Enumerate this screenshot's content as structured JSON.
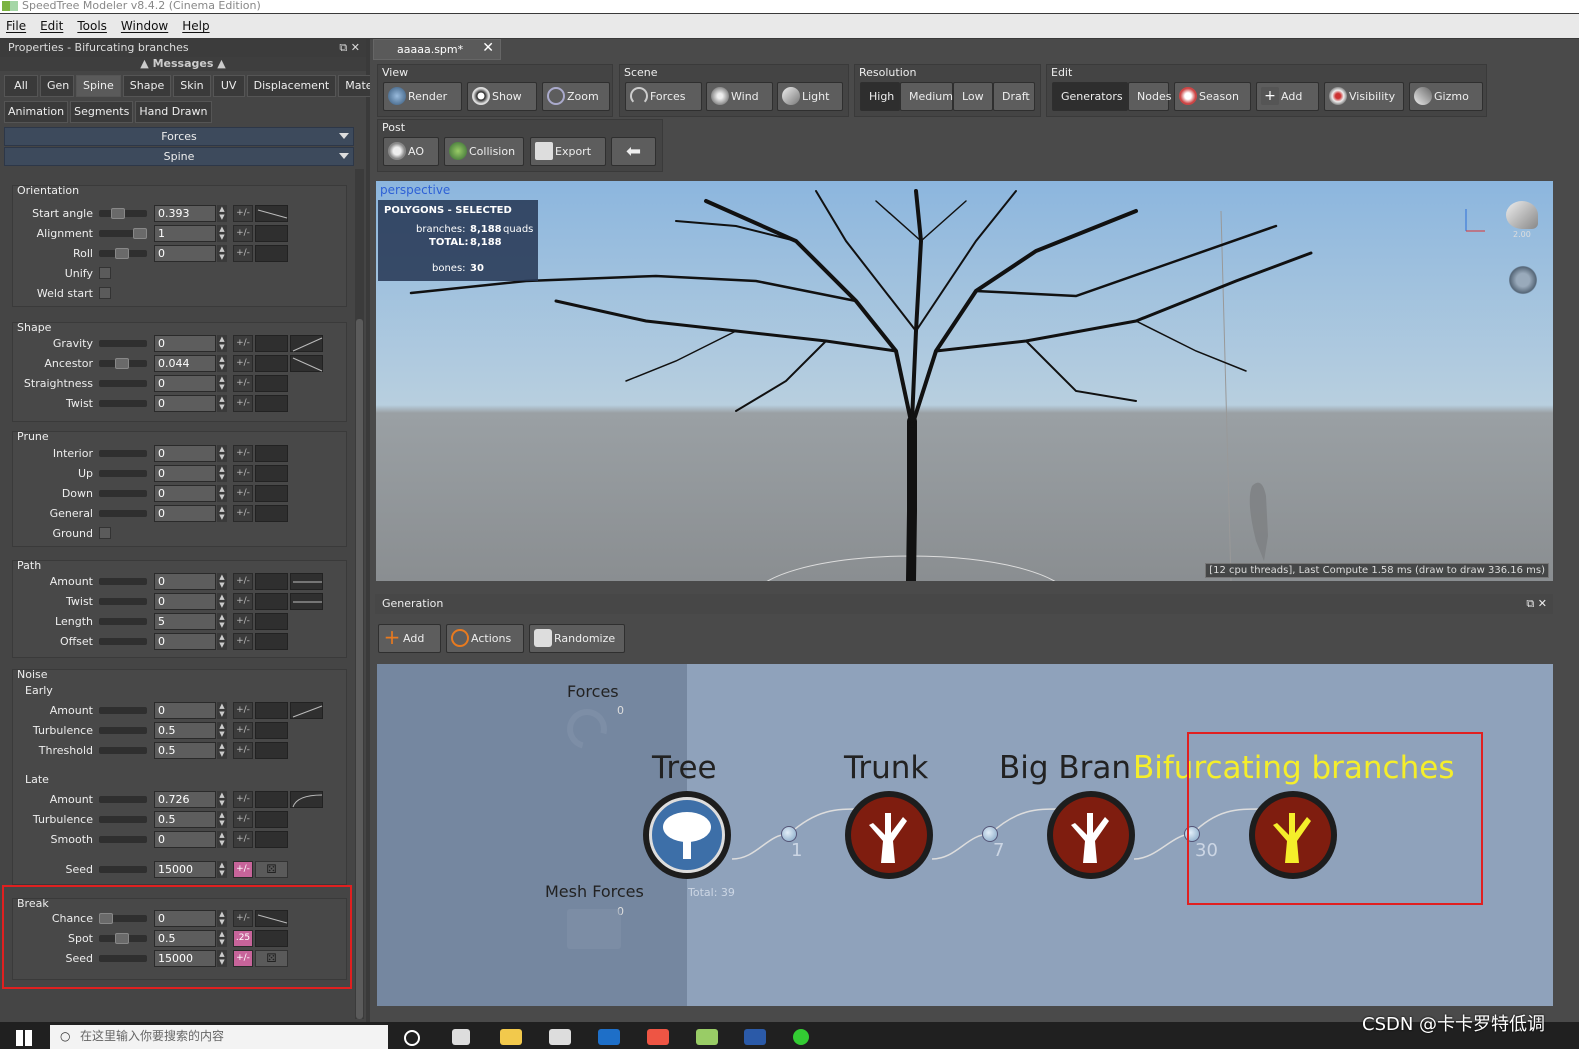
{
  "window": {
    "title": "SpeedTree Modeler v8.4.2 (Cinema Edition)"
  },
  "menu": {
    "items": [
      "File",
      "Edit",
      "Tools",
      "Window",
      "Help"
    ]
  },
  "properties": {
    "title": "Properties - Bifurcating branches",
    "messages_label": "Messages",
    "tabs_row1": [
      "All",
      "Gen",
      "Spine",
      "Shape",
      "Skin",
      "UV",
      "Displacement",
      "Material"
    ],
    "active_tab": "Spine",
    "tabs_row2": [
      "Animation",
      "Segments",
      "Hand Drawn"
    ],
    "dropdowns": [
      "Forces",
      "Spine"
    ],
    "groups": {
      "orientation": {
        "title": "Orientation",
        "rows": [
          {
            "label": "Start angle",
            "value": "0.393",
            "knob": 0.3
          },
          {
            "label": "Alignment",
            "value": "1",
            "knob": 0.75
          },
          {
            "label": "Roll",
            "value": "0",
            "knob": 0.4
          },
          {
            "label": "Unify"
          },
          {
            "label": "Weld start"
          }
        ]
      },
      "shape": {
        "title": "Shape",
        "rows": [
          {
            "label": "Gravity",
            "value": "0"
          },
          {
            "label": "Ancestor",
            "value": "0.044",
            "knob": 0.4
          },
          {
            "label": "Straightness",
            "value": "0"
          },
          {
            "label": "Twist",
            "value": "0"
          }
        ]
      },
      "prune": {
        "title": "Prune",
        "rows": [
          {
            "label": "Interior",
            "value": "0"
          },
          {
            "label": "Up",
            "value": "0"
          },
          {
            "label": "Down",
            "value": "0"
          },
          {
            "label": "General",
            "value": "0"
          },
          {
            "label": "Ground"
          }
        ]
      },
      "path": {
        "title": "Path",
        "rows": [
          {
            "label": "Amount",
            "value": "0"
          },
          {
            "label": "Twist",
            "value": "0"
          },
          {
            "label": "Length",
            "value": "5"
          },
          {
            "label": "Offset",
            "value": "0"
          }
        ]
      },
      "noise": {
        "title": "Noise",
        "early_title": "Early",
        "early": [
          {
            "label": "Amount",
            "value": "0"
          },
          {
            "label": "Turbulence",
            "value": "0.5"
          },
          {
            "label": "Threshold",
            "value": "0.5"
          }
        ],
        "late_title": "Late",
        "late": [
          {
            "label": "Amount",
            "value": "0.726"
          },
          {
            "label": "Turbulence",
            "value": "0.5"
          },
          {
            "label": "Smooth",
            "value": "0"
          }
        ],
        "seed": {
          "label": "Seed",
          "value": "15000"
        }
      },
      "break": {
        "title": "Break",
        "rows": [
          {
            "label": "Chance",
            "value": "0"
          },
          {
            "label": "Spot",
            "value": "0.5",
            "knob": 0.4,
            "pm": ".25"
          },
          {
            "label": "Seed",
            "value": "15000"
          }
        ]
      }
    },
    "pm_label": "+/-"
  },
  "document": {
    "tab_name": "aaaaa.spm*"
  },
  "toolbar": {
    "view": {
      "title": "View",
      "buttons": [
        "Render",
        "Show",
        "Zoom"
      ]
    },
    "scene": {
      "title": "Scene",
      "buttons": [
        "Forces",
        "Wind",
        "Light"
      ]
    },
    "resolution": {
      "title": "Resolution",
      "buttons": [
        "High",
        "Medium",
        "Low",
        "Draft"
      ],
      "active": "High"
    },
    "edit": {
      "title": "Edit",
      "buttons": [
        "Generators",
        "Nodes",
        "Season",
        "Add",
        "Visibility",
        "Gizmo"
      ],
      "active": "Generators"
    },
    "post": {
      "title": "Post",
      "buttons": [
        "AO",
        "Collision",
        "Export"
      ]
    }
  },
  "viewport": {
    "label": "perspective",
    "stats_title": "POLYGONS - SELECTED",
    "branches_label": "branches:",
    "branches_value": "8,188",
    "branches_unit": "quads",
    "total_label": "TOTAL:",
    "total_value": "8,188",
    "bones_label": "bones:",
    "bones_value": "30",
    "light_value": "2.00",
    "perf": "[12 cpu threads], Last Compute 1.58 ms (draw to draw 336.16 ms)"
  },
  "generation": {
    "title": "Generation",
    "buttons": [
      "Add",
      "Actions",
      "Randomize"
    ],
    "forces_label": "Forces",
    "forces_count": "0",
    "mesh_forces_label": "Mesh Forces",
    "mesh_forces_count": "0",
    "total": "Total: 39",
    "nodes": [
      {
        "label": "Tree",
        "count": ""
      },
      {
        "label": "Trunk",
        "count": "1"
      },
      {
        "label": "Big Bran",
        "count": "7"
      },
      {
        "label": "Bifurcating branches",
        "count": "30"
      }
    ]
  },
  "taskbar": {
    "search_placeholder": "在这里输入你要搜索的内容"
  },
  "watermark": "CSDN @卡卡罗特低调",
  "colors": {
    "selected_node": "#f5ee2a",
    "highlight_box": "#e02020",
    "node_fill": "#7f1d0f"
  }
}
